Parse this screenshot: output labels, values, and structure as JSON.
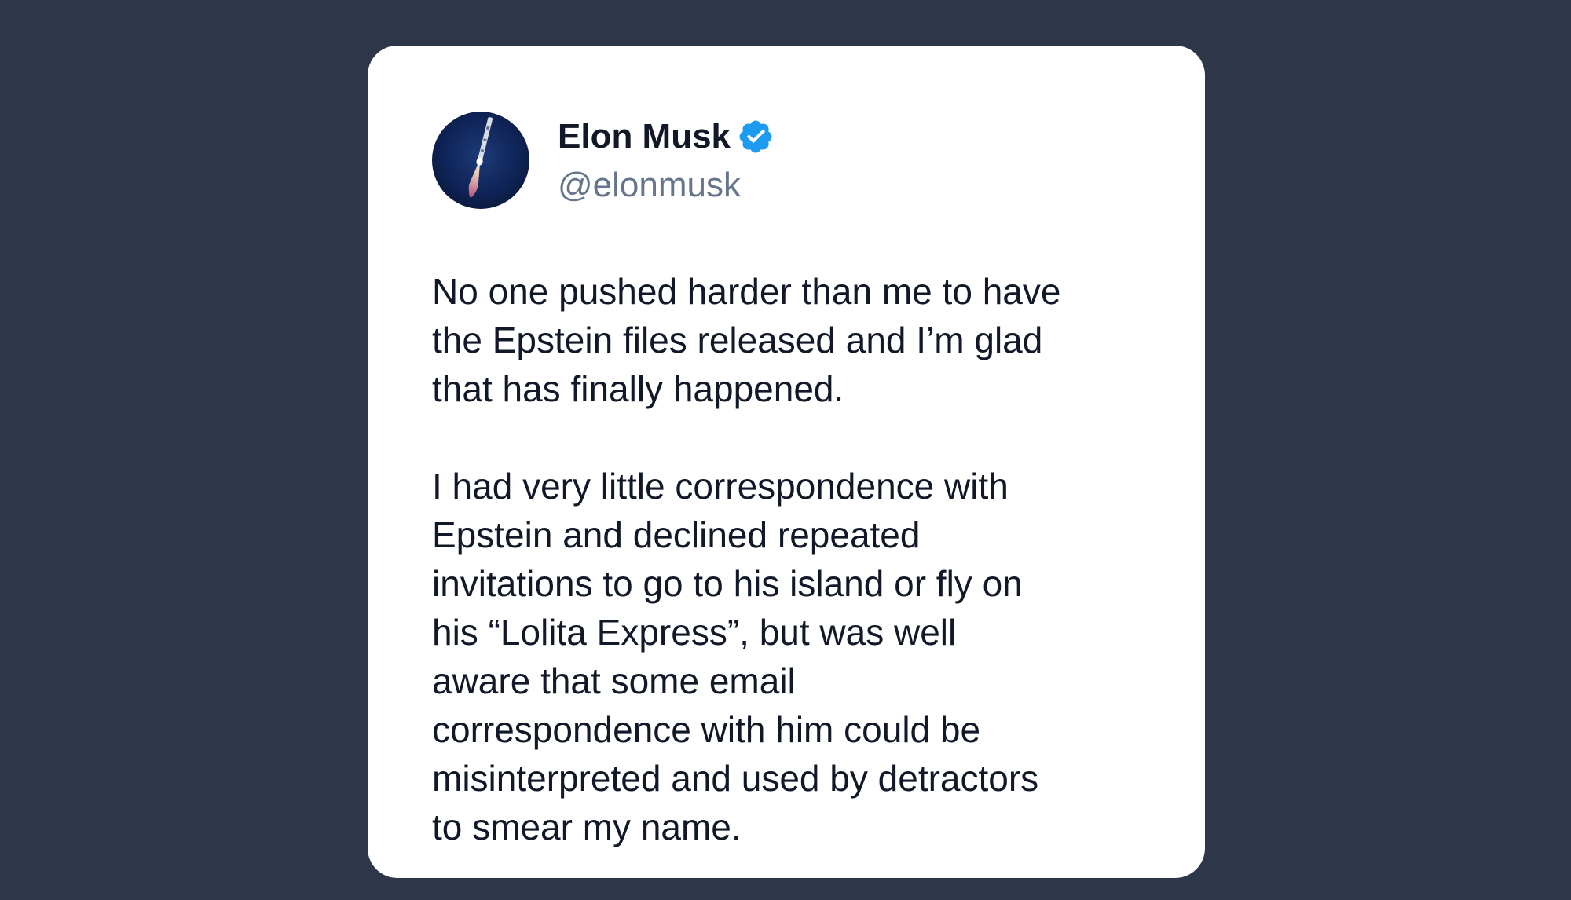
{
  "tweet": {
    "author": {
      "name": "Elon Musk",
      "handle": "@elonmusk",
      "verified": true,
      "avatar_icon": "rocket-launch-avatar"
    },
    "paragraphs": [
      {
        "lines": [
          "No one pushed harder than me to have",
          "the Epstein files released and I’m glad",
          "that has finally happened."
        ]
      },
      {
        "lines": [
          "I had very little correspondence with",
          "Epstein and declined repeated",
          "invitations to go to his island or fly on",
          "his “Lolita Express”, but was well",
          "aware that some email",
          "correspondence with him could be",
          "misinterpreted and used by detractors",
          "to smear my name."
        ]
      }
    ]
  },
  "colors": {
    "page_background": "#2e3749",
    "card_background": "#ffffff",
    "text_primary": "#111827",
    "text_secondary": "#66758b",
    "verified_badge": "#1d9bf0"
  }
}
